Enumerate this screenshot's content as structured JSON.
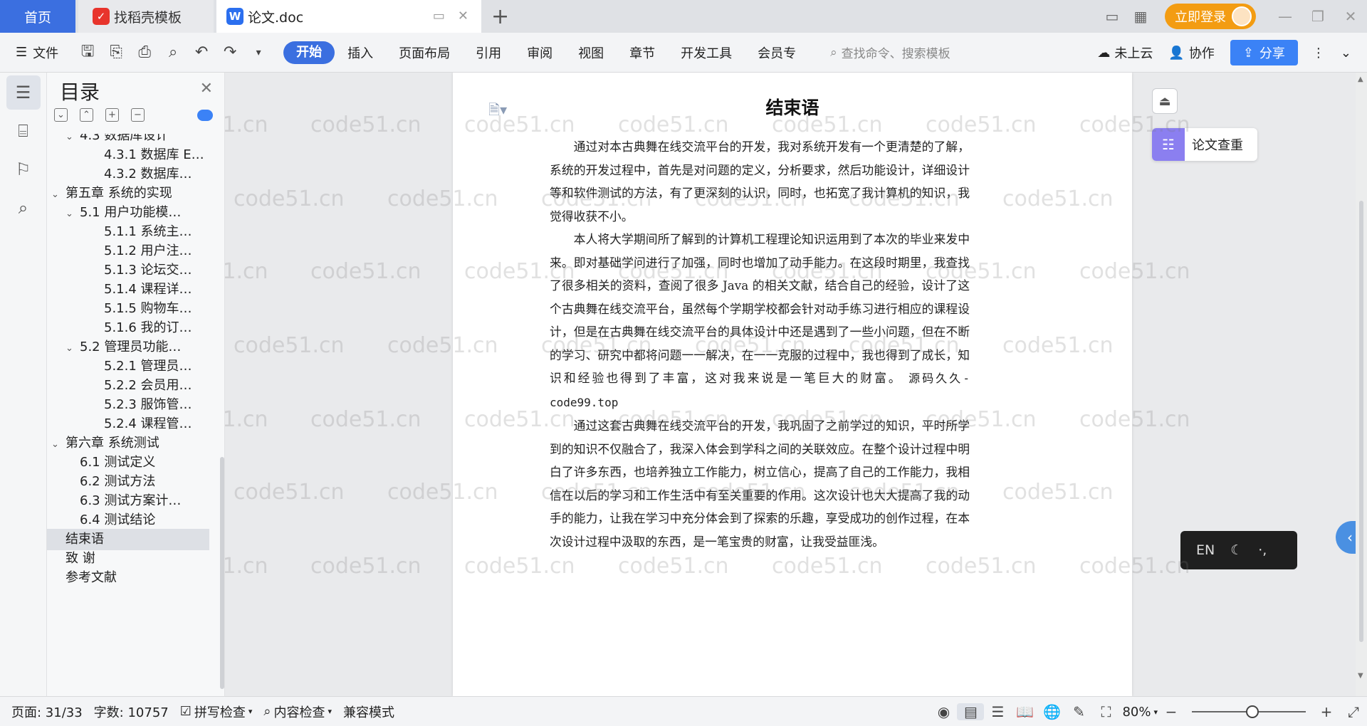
{
  "titlebar": {
    "tabs": [
      {
        "label": "首页"
      },
      {
        "label": "找稻壳模板"
      },
      {
        "label": "论文.doc"
      }
    ],
    "login_label": "立即登录"
  },
  "ribbon": {
    "file_label": "文件",
    "tabs": [
      "开始",
      "插入",
      "页面布局",
      "引用",
      "审阅",
      "视图",
      "章节",
      "开发工具",
      "会员专"
    ],
    "search_placeholder": "查找命令、搜索模板",
    "cloud_label": "未上云",
    "collab_label": "协作",
    "share_label": "分享"
  },
  "toc": {
    "title": "目录",
    "items": [
      {
        "label": "4.3 数据库设计",
        "level": 2,
        "expand": true
      },
      {
        "label": "4.3.1 数据库 E…",
        "level": 3
      },
      {
        "label": "4.3.2 数据库…",
        "level": 3
      },
      {
        "label": "第五章  系统的实现",
        "level": 1,
        "expand": true
      },
      {
        "label": "5.1  用户功能模…",
        "level": 2,
        "expand": true
      },
      {
        "label": "5.1.1 系统主…",
        "level": 3
      },
      {
        "label": "5.1.2 用户注…",
        "level": 3
      },
      {
        "label": "5.1.3 论坛交…",
        "level": 3
      },
      {
        "label": "5.1.4 课程详…",
        "level": 3
      },
      {
        "label": "5.1.5 购物车…",
        "level": 3
      },
      {
        "label": "5.1.6 我的订…",
        "level": 3
      },
      {
        "label": "5.2  管理员功能…",
        "level": 2,
        "expand": true
      },
      {
        "label": "5.2.1 管理员…",
        "level": 3
      },
      {
        "label": "5.2.2 会员用…",
        "level": 3
      },
      {
        "label": "5.2.3 服饰管…",
        "level": 3
      },
      {
        "label": "5.2.4 课程管…",
        "level": 3
      },
      {
        "label": "第六章    系统测试",
        "level": 1,
        "expand": true
      },
      {
        "label": "6.1 测试定义",
        "level": 2
      },
      {
        "label": "6.2 测试方法",
        "level": 2
      },
      {
        "label": "6.3 测试方案计…",
        "level": 2
      },
      {
        "label": "6.4 测试结论",
        "level": 2
      },
      {
        "label": "结束语",
        "level": 1,
        "selected": true
      },
      {
        "label": "致    谢",
        "level": 1
      },
      {
        "label": "参考文献",
        "level": 1
      }
    ]
  },
  "document": {
    "title": "结束语",
    "paragraphs": [
      "通过对本古典舞在线交流平台的开发，我对系统开发有一个更清楚的了解，系统的开发过程中，首先是对问题的定义，分析要求，然后功能设计，详细设计等和软件测试的方法，有了更深刻的认识，同时，也拓宽了我计算机的知识，我觉得收获不小。",
      "本人将大学期间所了解到的计算机工程理论知识运用到了本次的毕业来发中来。即对基础学问进行了加强，同时也增加了动手能力。在这段时期里，我查找了很多相关的资料，查阅了很多 Java 的相关文献，结合自己的经验，设计了这个古典舞在线交流平台，虽然每个学期学校都会针对动手练习进行相应的课程设计，但是在古典舞在线交流平台的具体设计中还是遇到了一些小问题，但在不断的学习、研究中都将问题一一解决，在一一克服的过程中，我也得到了成长，知识和经验也得到了丰富，这对我来说是一笔巨大的财富。",
      "通过这套古典舞在线交流平台的开发，我巩固了之前学过的知识，平时所学到的知识不仅融合了，我深入体会到学科之间的关联效应。在整个设计过程中明白了许多东西，也培养独立工作能力，树立信心，提高了自己的工作能力，我相信在以后的学习和工作生活中有至关重要的作用。这次设计也大大提高了我的动手的能力，让我在学习中充分体会到了探索的乐趣，享受成功的创作过程，在本次设计过程中汲取的东西，是一笔宝贵的财富，让我受益匪浅。"
    ],
    "inline_note": "源码久久-code99.top"
  },
  "watermark_text": "code51.cn",
  "side_panel": {
    "check_label": "论文查重",
    "ime_lang": "EN"
  },
  "statusbar": {
    "page": "页面: 31/33",
    "words": "字数: 10757",
    "spell": "拼写检查",
    "content": "内容检查",
    "compat": "兼容模式",
    "zoom": "80%"
  },
  "colors": {
    "accent": "#3b6fe0",
    "login": "#f39c12",
    "share": "#3b82f6"
  }
}
